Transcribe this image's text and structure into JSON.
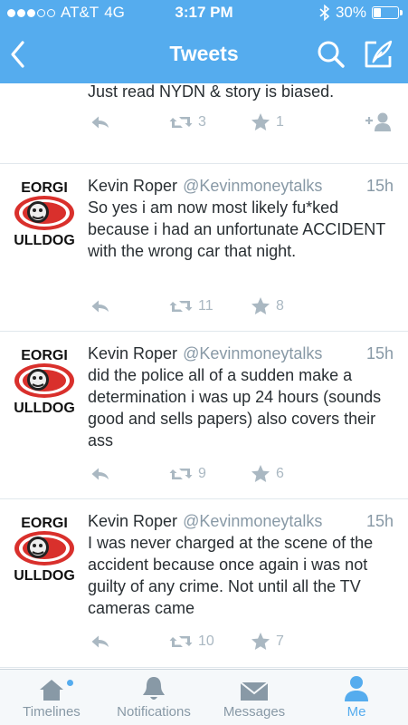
{
  "status_bar": {
    "carrier": "AT&T",
    "network": "4G",
    "time": "3:17 PM",
    "battery": "30%",
    "battery_level": 0.3,
    "signal_bars_filled": 3,
    "signal_bars_total": 5
  },
  "nav": {
    "title": "Tweets",
    "back_icon": "chevron-left-icon",
    "search_icon": "search-icon",
    "compose_icon": "compose-icon"
  },
  "colors": {
    "brand": "#55acee",
    "muted": "#8899a6",
    "icon_gray": "#aab8c2"
  },
  "tweets": [
    {
      "text": "Just read NYDN & story is biased.",
      "retweets": "3",
      "favorites": "1",
      "partial": true
    },
    {
      "name": "Kevin Roper",
      "handle": "@Kevinmoneytalks",
      "time": "15h",
      "text": "So yes i am now most likely fu*ked because i had an unfortunate ACCIDENT with the wrong car that night.",
      "retweets": "11",
      "favorites": "8",
      "avatar_text_top": "EORGI",
      "avatar_text_bottom": "ULLDOG"
    },
    {
      "name": "Kevin Roper",
      "handle": "@Kevinmoneytalks",
      "time": "15h",
      "text": "did the police all of a sudden make a determination i was up 24 hours (sounds good and sells papers) also covers their ass",
      "retweets": "9",
      "favorites": "6",
      "avatar_text_top": "EORGI",
      "avatar_text_bottom": "ULLDOG"
    },
    {
      "name": "Kevin Roper",
      "handle": "@Kevinmoneytalks",
      "time": "15h",
      "text": "I was never charged at the scene of the accident because once again i was not guilty of any crime. Not until all the TV cameras came",
      "retweets": "10",
      "favorites": "7",
      "avatar_text_top": "EORGI",
      "avatar_text_bottom": "ULLDOG"
    }
  ],
  "tabs": [
    {
      "label": "Timelines",
      "icon": "home-icon",
      "active": false
    },
    {
      "label": "Notifications",
      "icon": "bell-icon",
      "active": false
    },
    {
      "label": "Messages",
      "icon": "envelope-icon",
      "active": false
    },
    {
      "label": "Me",
      "icon": "person-icon",
      "active": true
    }
  ]
}
